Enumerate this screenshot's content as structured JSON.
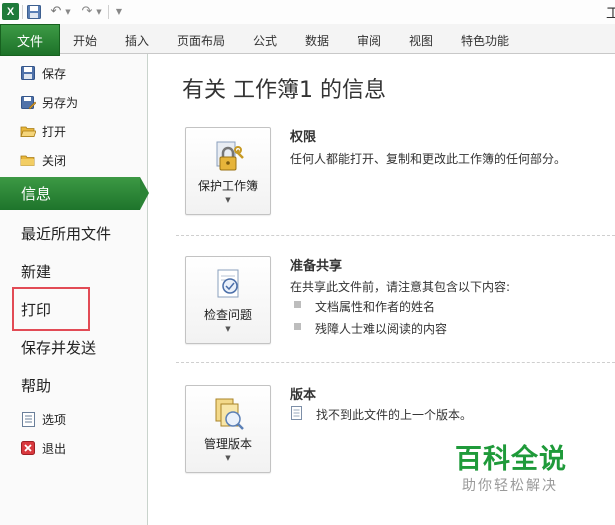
{
  "title_bar": {
    "app_icon_letter": "X",
    "window_title": "工"
  },
  "ribbon": {
    "file_tab": "文件",
    "tabs": [
      "开始",
      "插入",
      "页面布局",
      "公式",
      "数据",
      "审阅",
      "视图",
      "特色功能"
    ]
  },
  "nav": {
    "save": "保存",
    "save_as": "另存为",
    "open": "打开",
    "close": "关闭",
    "info": "信息",
    "recent": "最近所用文件",
    "new": "新建",
    "print": "打印",
    "save_send": "保存并发送",
    "help": "帮助",
    "options": "选项",
    "exit": "退出"
  },
  "main": {
    "title": "有关 工作簿1 的信息",
    "permissions": {
      "button_label": "保护工作簿",
      "heading": "权限",
      "description": "任何人都能打开、复制和更改此工作簿的任何部分。"
    },
    "prepare": {
      "button_label": "检查问题",
      "heading": "准备共享",
      "description": "在共享此文件前，请注意其包含以下内容:",
      "bullets": [
        "文档属性和作者的姓名",
        "残障人士难以阅读的内容"
      ]
    },
    "versions": {
      "button_label": "管理版本",
      "heading": "版本",
      "description": "找不到此文件的上一个版本。"
    }
  },
  "watermark": {
    "title": "百科全说",
    "subtitle": "助你轻松解决"
  },
  "colors": {
    "accent_green": "#2b8436",
    "highlight_red": "#e24b55",
    "watermark_green": "#1f9a3a"
  }
}
